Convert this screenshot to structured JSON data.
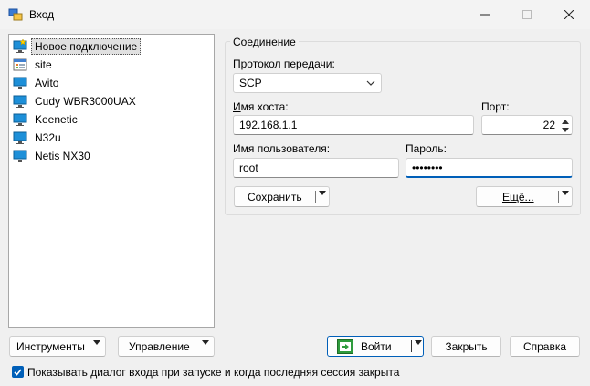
{
  "window": {
    "title": "Вход"
  },
  "sessions": [
    {
      "label": "Новое подключение",
      "icon": "new-site-icon"
    },
    {
      "label": "site",
      "icon": "site-folder-icon"
    },
    {
      "label": "Avito",
      "icon": "monitor-icon"
    },
    {
      "label": "Cudy WBR3000UAX",
      "icon": "monitor-icon"
    },
    {
      "label": "Keenetic",
      "icon": "monitor-icon"
    },
    {
      "label": "N32u",
      "icon": "monitor-icon"
    },
    {
      "label": "Netis NX30",
      "icon": "monitor-icon"
    }
  ],
  "connection": {
    "group_title": "Соединение",
    "protocol_label": "Протокол передачи:",
    "protocol_value": "SCP",
    "host_label": "Имя хоста:",
    "host_value": "192.168.1.1",
    "port_label": "Порт:",
    "port_value": "22",
    "user_label": "Имя пользователя:",
    "user_value": "root",
    "password_label": "Пароль:",
    "password_value": "••••••••",
    "save_label": "Сохранить",
    "more_label": "Ещё..."
  },
  "bottom": {
    "tools_label": "Инструменты",
    "manage_label": "Управление",
    "login_label": "Войти",
    "close_label": "Закрыть",
    "help_label": "Справка",
    "show_dialog_label": "Показывать диалог входа при запуске и когда последняя сессия закрыта"
  },
  "colors": {
    "accent": "#005fb8",
    "monitor": "#1d8fd8"
  }
}
